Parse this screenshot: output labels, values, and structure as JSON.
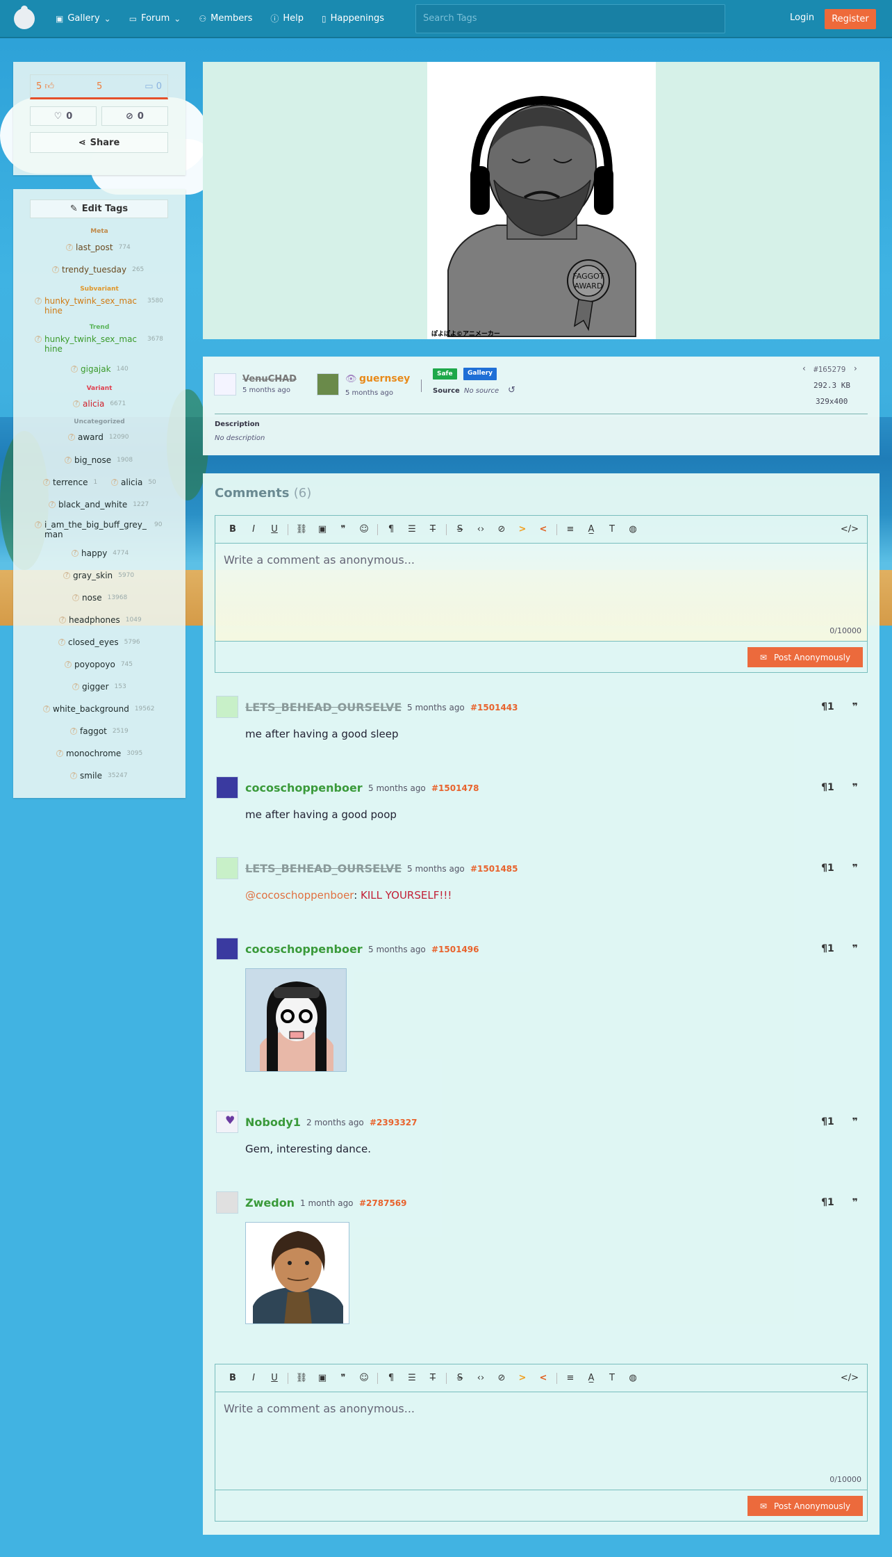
{
  "nav": {
    "gallery": "Gallery",
    "forum": "Forum",
    "members": "Members",
    "help": "Help",
    "happenings": "Happenings",
    "search_placeholder": "Search Tags",
    "login": "Login",
    "register": "Register"
  },
  "votes": {
    "up": "5",
    "score": "5",
    "down": "0",
    "favorites": "0",
    "hidden": "0",
    "share": "Share"
  },
  "tags_panel": {
    "edit_label": "Edit Tags",
    "categories": {
      "meta": "Meta",
      "subvariant": "Subvariant",
      "trend": "Trend",
      "variant": "Variant",
      "uncategorized": "Uncategorized"
    },
    "tags": [
      {
        "name": "last_post",
        "count": "774"
      },
      {
        "name": "trendy_tuesday",
        "count": "265"
      },
      {
        "name": "hunky_twink_sex_machine",
        "count": "3580"
      },
      {
        "name": "hunky_twink_sex_machine",
        "count": "3678"
      },
      {
        "name": "gigajak",
        "count": "140"
      },
      {
        "name": "alicia",
        "count": "6671"
      },
      {
        "name": "award",
        "count": "12090"
      },
      {
        "name": "big_nose",
        "count": "1908"
      },
      {
        "name": "terrence",
        "count": "1"
      },
      {
        "name": "alicia",
        "count": "50"
      },
      {
        "name": "black_and_white",
        "count": "1227"
      },
      {
        "name": "i_am_the_big_buff_grey_man",
        "count": "90"
      },
      {
        "name": "happy",
        "count": "4774"
      },
      {
        "name": "gray_skin",
        "count": "5970"
      },
      {
        "name": "nose",
        "count": "13968"
      },
      {
        "name": "headphones",
        "count": "1049"
      },
      {
        "name": "closed_eyes",
        "count": "5796"
      },
      {
        "name": "poyopoyo",
        "count": "745"
      },
      {
        "name": "gigger",
        "count": "153"
      },
      {
        "name": "white_background",
        "count": "19562"
      },
      {
        "name": "faggot",
        "count": "2519"
      },
      {
        "name": "monochrome",
        "count": "3095"
      },
      {
        "name": "smile",
        "count": "35247"
      }
    ]
  },
  "image": {
    "badge_text": "FAGGOT AWARD",
    "caption": "ぽよぽよ©アニメーカー"
  },
  "info": {
    "uploader": "VenuCHAD",
    "uploader_time": "5 months ago",
    "approver": "guernsey",
    "approver_time": "5 months ago",
    "badge_safe": "Safe",
    "badge_gallery": "Gallery",
    "source_label": "Source",
    "source_value": "No source",
    "post_id": "#165279",
    "file_size": "292.3 KB",
    "dimensions": "329x400",
    "description_label": "Description",
    "description_value": "No description"
  },
  "comments": {
    "title": "Comments",
    "count": "(6)",
    "placeholder": "Write a comment as anonymous...",
    "counter": "0/10000",
    "post_label": "Post Anonymously",
    "items": [
      {
        "user": "LETS_BEHEAD_OURSELVE",
        "time": "5 months ago",
        "id": "#1501443",
        "text": "me after having a good sleep"
      },
      {
        "user": "cocoschoppenboer",
        "time": "5 months ago",
        "id": "#1501478",
        "text": "me after having a good poop"
      },
      {
        "user": "LETS_BEHEAD_OURSELVE",
        "time": "5 months ago",
        "id": "#1501485",
        "mention": "@cocoschoppenboer",
        "text": "KILL YOURSELF!!!"
      },
      {
        "user": "cocoschoppenboer",
        "time": "5 months ago",
        "id": "#1501496"
      },
      {
        "user": "Nobody1",
        "time": "2 months ago",
        "id": "#2393327",
        "text": "Gem, interesting dance."
      },
      {
        "user": "Zwedon",
        "time": "1 month ago",
        "id": "#2787569"
      }
    ]
  },
  "colors": {
    "accent": "#ec6a3c",
    "nav": "#1a8ab0",
    "user_green": "#3a9a3a"
  }
}
